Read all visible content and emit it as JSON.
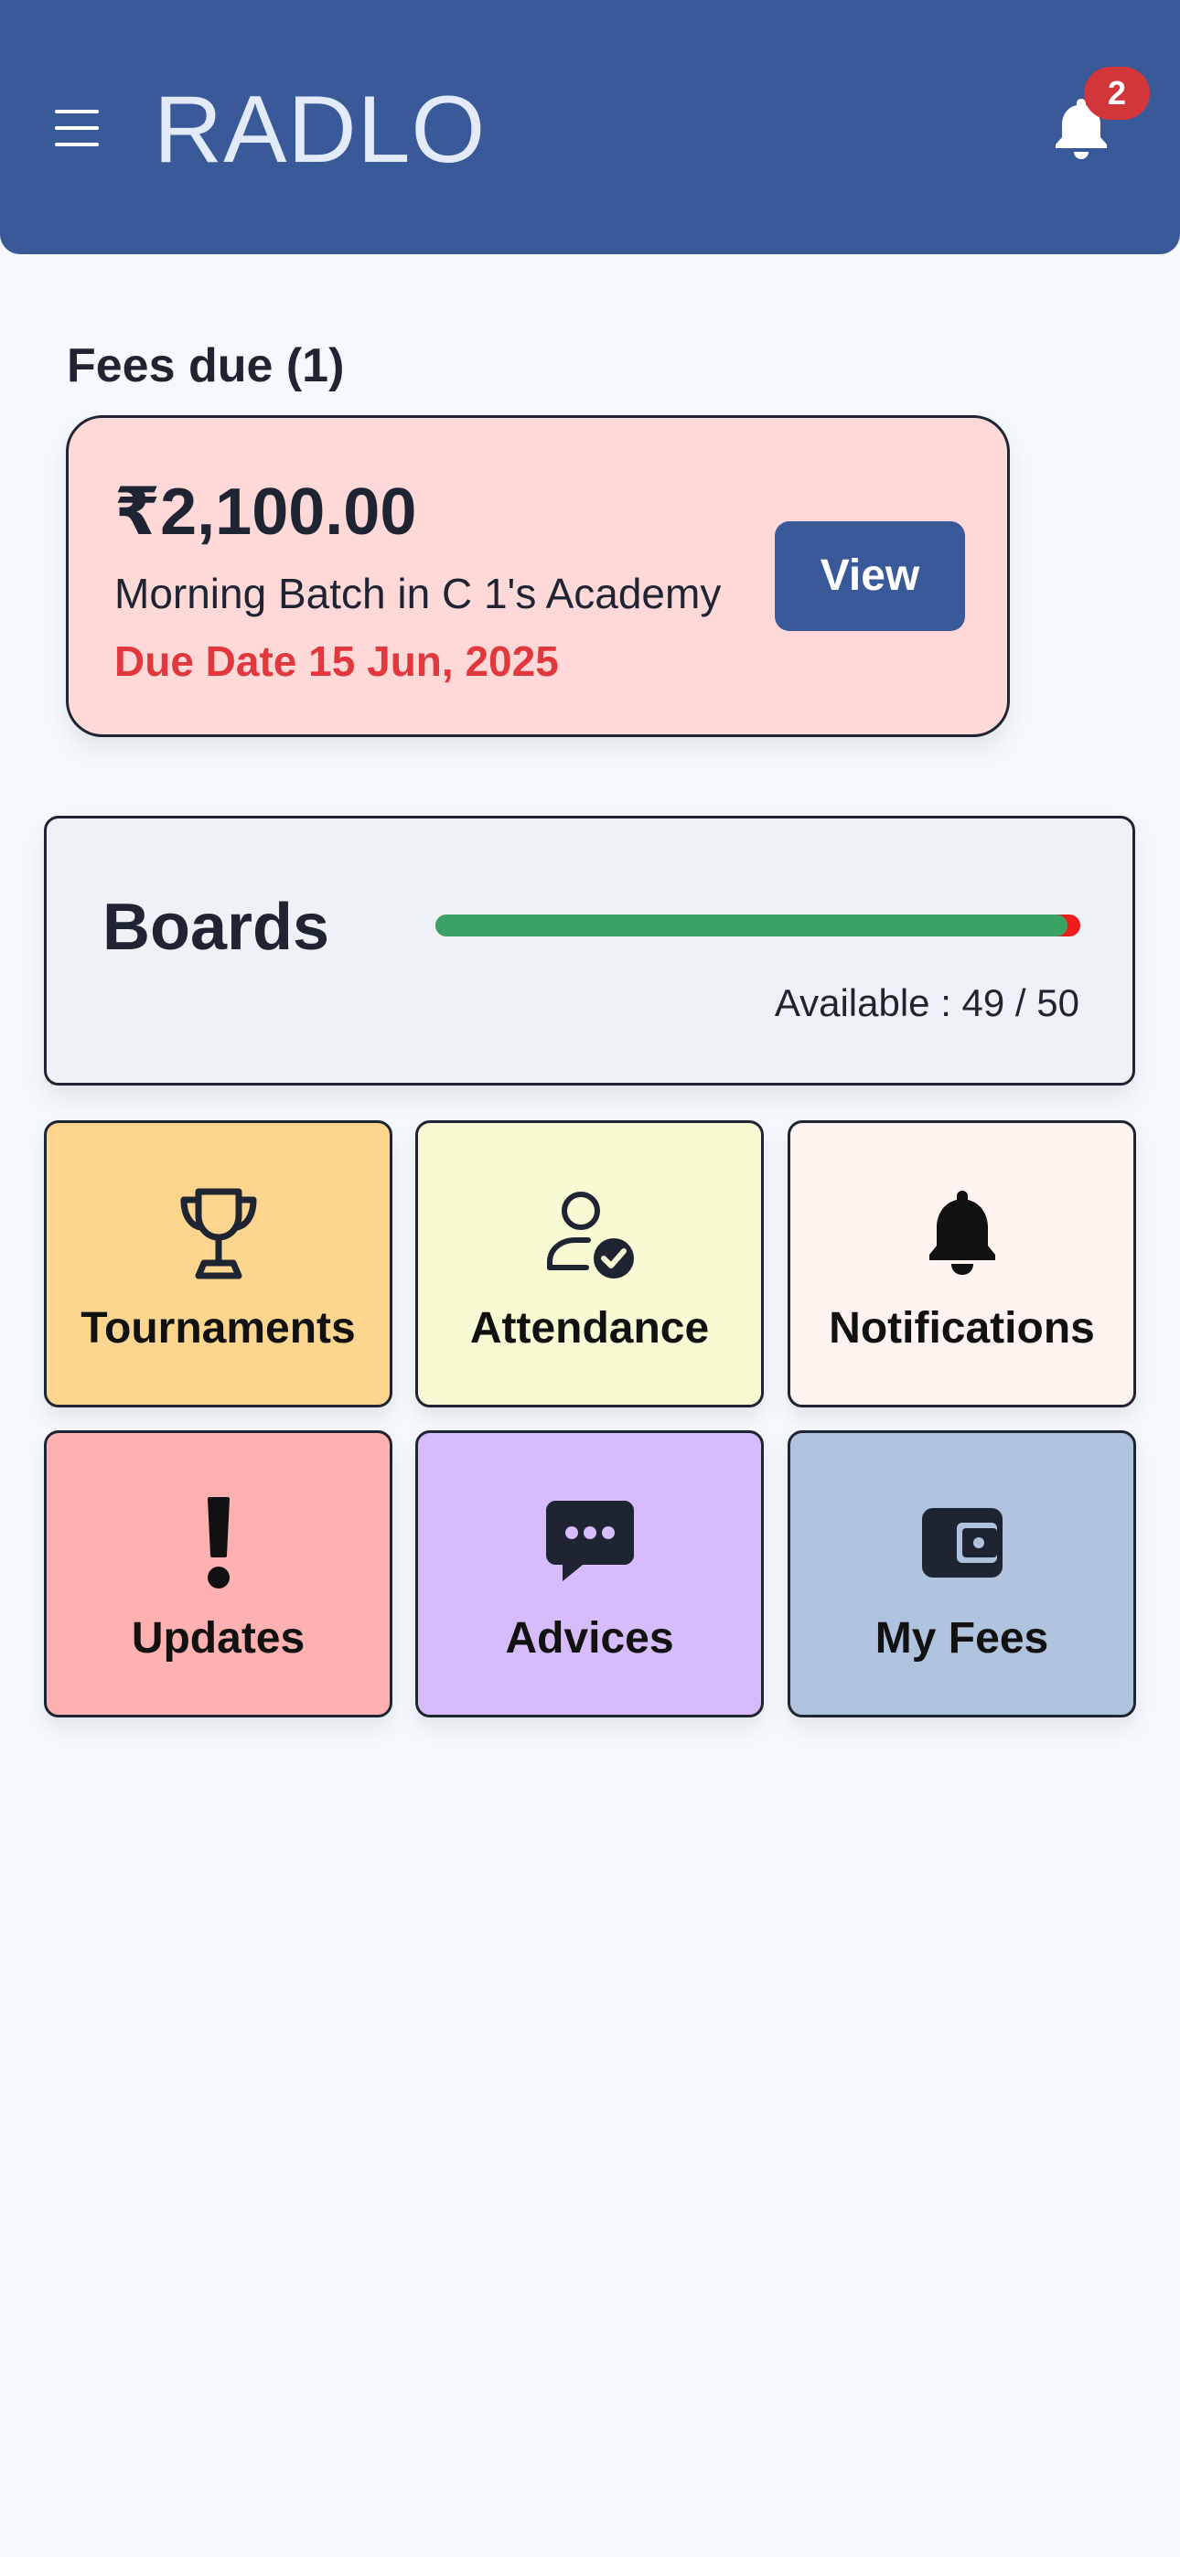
{
  "header": {
    "title": "RADLO",
    "menu_icon": "hamburger-menu-icon",
    "bell_icon": "bell-icon",
    "notification_count": "2",
    "background_color": "#3a5998"
  },
  "fees": {
    "section_title": "Fees due (1)",
    "card": {
      "amount": "₹2,100.00",
      "description": "Morning Batch in C 1's Academy",
      "due_date": "Due Date 15 Jun, 2025",
      "view_label": "View",
      "background_color": "#ffd8d8",
      "due_color": "#e0383c"
    }
  },
  "boards": {
    "title": "Boards",
    "available_text": "Available : 49 / 50",
    "available": 49,
    "total": 50,
    "fill_color": "#3aa264",
    "remaining_color": "#ef1c1c"
  },
  "tiles": [
    {
      "label": "Tournaments",
      "icon": "trophy-icon",
      "color": "#fcd68e"
    },
    {
      "label": "Attendance",
      "icon": "user-check-icon",
      "color": "#f8fad4"
    },
    {
      "label": "Notifications",
      "icon": "bell-icon",
      "color": "#fff3f0"
    },
    {
      "label": "Updates",
      "icon": "exclamation-icon",
      "color": "#ffb0b0"
    },
    {
      "label": "Advices",
      "icon": "chat-bubble-icon",
      "color": "#d6bcfa"
    },
    {
      "label": "My Fees",
      "icon": "wallet-icon",
      "color": "#afc3de"
    }
  ]
}
